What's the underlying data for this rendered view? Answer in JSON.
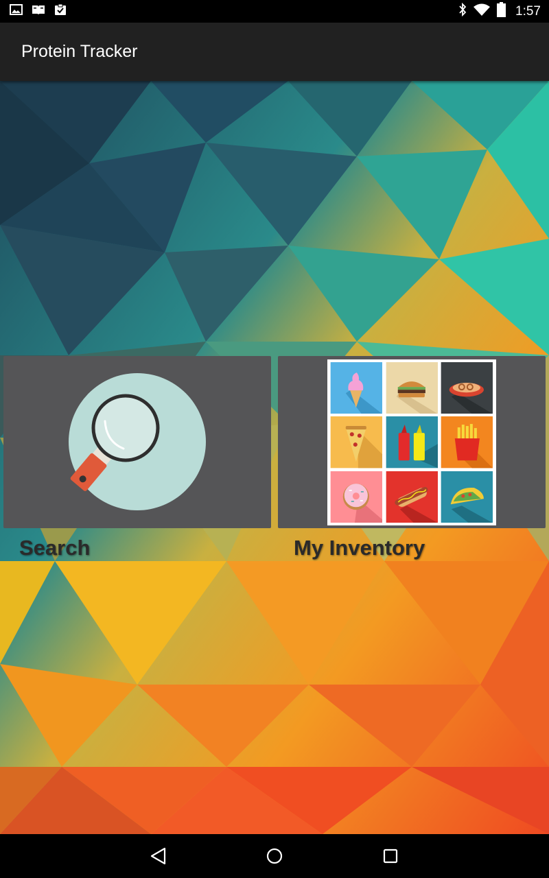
{
  "status_bar": {
    "time": "1:57",
    "left_icons": [
      "image-icon",
      "book-icon",
      "clipboard-check-icon"
    ],
    "right_icons": [
      "bluetooth-icon",
      "wifi-icon",
      "battery-icon"
    ]
  },
  "app": {
    "title": "Protein Tracker"
  },
  "tiles": [
    {
      "label": "Search",
      "icon": "magnifier-icon"
    },
    {
      "label": "My Inventory",
      "icon": "food-grid-icon"
    }
  ],
  "inventory_foods": [
    "ice-cream",
    "burger",
    "pretzel",
    "pizza-slice",
    "ketchup-mustard",
    "fries",
    "donut",
    "hot-dog",
    "taco"
  ],
  "nav_bar": {
    "buttons": [
      "back-icon",
      "home-icon",
      "recents-icon"
    ]
  },
  "colors": {
    "action_bar": "#212121",
    "tile_background": "#555557",
    "search_circle": "#b9dcd7",
    "magnifier_handle": "#e05a3a"
  }
}
